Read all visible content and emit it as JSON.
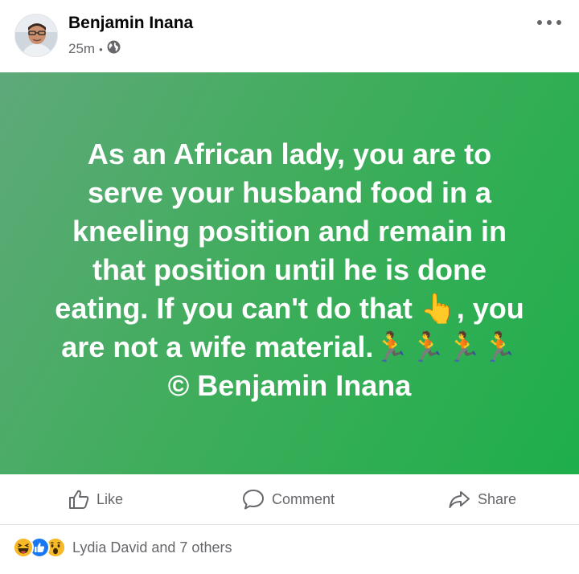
{
  "post": {
    "author": "Benjamin Inana",
    "time": "25m",
    "separator": "•",
    "body": "As an African lady, you are to\nserve your husband food in a\nkneeling position and remain in\nthat position until he is done\neating. If you can't do that 👆, you\nare not a wife material.🏃🏃🏃🏃\n© Benjamin Inana",
    "privacy_icon": "globe-icon",
    "banner_colors": [
      "#5fa97a",
      "#1eae4b"
    ]
  },
  "actions": {
    "like": "Like",
    "comment": "Comment",
    "share": "Share"
  },
  "reactions": {
    "icons": [
      "haha-reaction-icon",
      "like-reaction-icon",
      "wow-reaction-icon"
    ],
    "summary": "Lydia David and 7 others"
  },
  "colors": {
    "secondary_text": "#65676b",
    "like_blue": "#1877f2",
    "reaction_yellow": "#f7b928"
  }
}
